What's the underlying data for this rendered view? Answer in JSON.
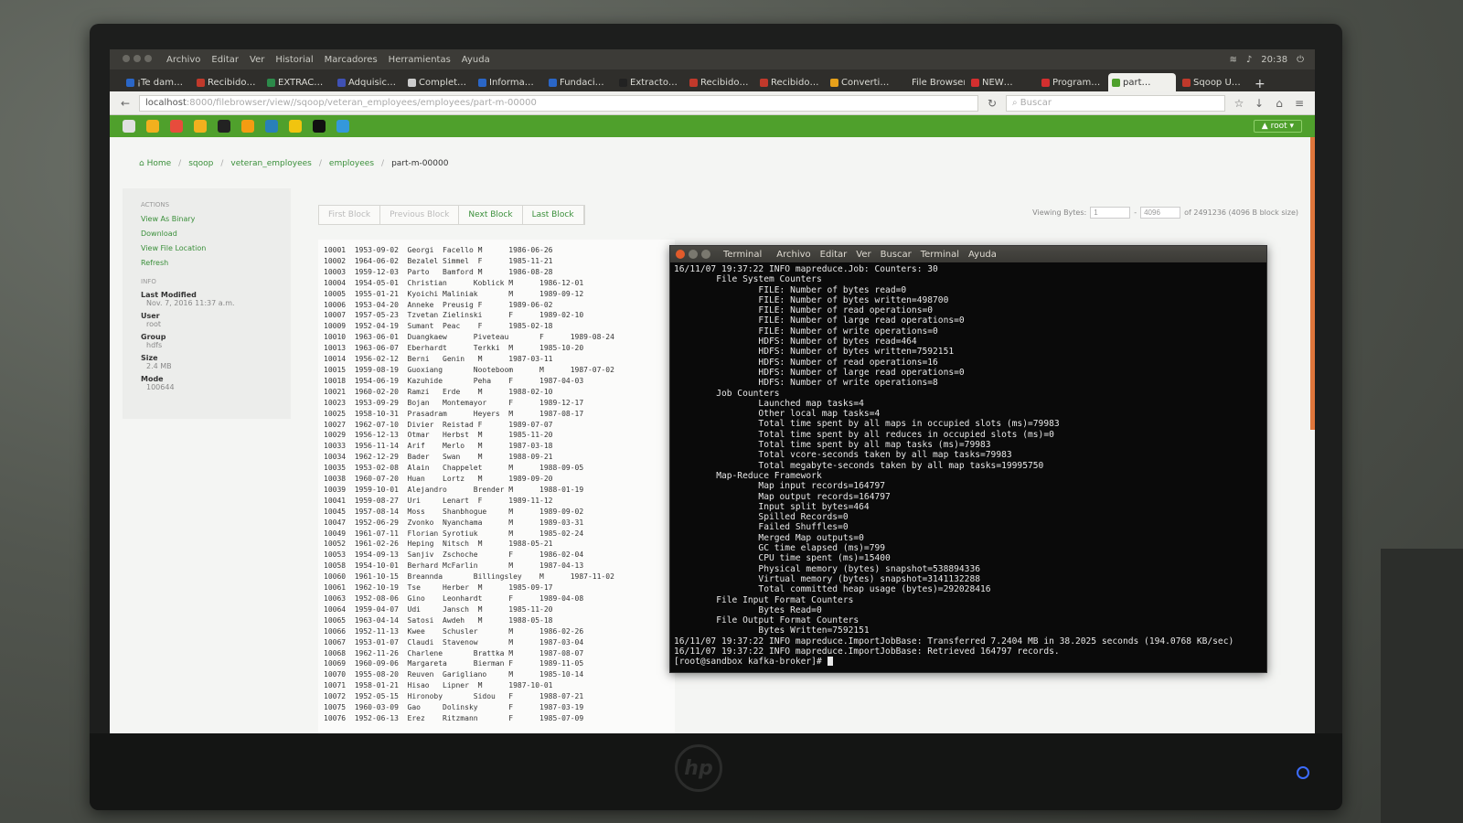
{
  "os_bar": {
    "menus": [
      "Archivo",
      "Editar",
      "Ver",
      "Historial",
      "Marcadores",
      "Herramientas",
      "Ayuda"
    ],
    "clock": "20:38"
  },
  "tabs": [
    {
      "label": "¡Te dam…",
      "color": "#2a66c7"
    },
    {
      "label": "Recibido…",
      "color": "#c0392b"
    },
    {
      "label": "EXTRAC…",
      "color": "#2c8a4a"
    },
    {
      "label": "Adquisic…",
      "color": "#3f51b5"
    },
    {
      "label": "Complet…",
      "color": "#cccccc"
    },
    {
      "label": "Informa…",
      "color": "#2a66c7"
    },
    {
      "label": "Fundaci…",
      "color": "#2a66c7"
    },
    {
      "label": "Extracto…",
      "color": "#222222"
    },
    {
      "label": "Recibido…",
      "color": "#c0392b"
    },
    {
      "label": "Recibido…",
      "color": "#c0392b"
    },
    {
      "label": "Converti…",
      "color": "#e6a01a"
    },
    {
      "label": "File Browser",
      "color": "#2f2e2b"
    },
    {
      "label": "NEW…",
      "color": "#d32f2f"
    },
    {
      "label": "Program…",
      "color": "#d32f2f"
    },
    {
      "label": "part…",
      "color": "#4fa02c",
      "active": true
    },
    {
      "label": "Sqoop U…",
      "color": "#c0392b"
    }
  ],
  "url": {
    "host": "localhost",
    "path": ":8000/filebrowser/view//sqoop/veteran_employees/employees/part-m-00000"
  },
  "search": {
    "placeholder": "Buscar"
  },
  "hue": {
    "user": "root"
  },
  "breadcrumb": {
    "home": "Home",
    "parts": [
      "sqoop",
      "veteran_employees",
      "employees"
    ],
    "current": "part-m-00000"
  },
  "sidebar": {
    "actions_header": "ACTIONS",
    "actions": [
      "View As Binary",
      "Download",
      "View File Location",
      "Refresh"
    ],
    "info_header": "INFO",
    "last_modified_label": "Last Modified",
    "last_modified": "Nov. 7, 2016 11:37 a.m.",
    "user_label": "User",
    "user": "root",
    "group_label": "Group",
    "group": "hdfs",
    "size_label": "Size",
    "size": "2.4 MB",
    "mode_label": "Mode",
    "mode": "100644"
  },
  "block_nav": {
    "first": "First Block",
    "previous": "Previous Block",
    "next": "Next Block",
    "last": "Last Block"
  },
  "viewing": {
    "label": "Viewing Bytes:",
    "from": "1",
    "to": "4096",
    "suffix": "of 2491236 (4096 B block size)"
  },
  "file_lines": [
    "10001  1953-09-02  Georgi  Facello M      1986-06-26",
    "10002  1964-06-02  Bezalel Simmel  F      1985-11-21",
    "10003  1959-12-03  Parto   Bamford M      1986-08-28",
    "10004  1954-05-01  Christian      Koblick M      1986-12-01",
    "10005  1955-01-21  Kyoichi Maliniak       M      1989-09-12",
    "10006  1953-04-20  Anneke  Preusig F      1989-06-02",
    "10007  1957-05-23  Tzvetan Zielinski      F      1989-02-10",
    "10009  1952-04-19  Sumant  Peac    F      1985-02-18",
    "10010  1963-06-01  Duangkaew      Piveteau       F      1989-08-24",
    "10013  1963-06-07  Eberhardt      Terkki  M      1985-10-20",
    "10014  1956-02-12  Berni   Genin   M      1987-03-11",
    "10015  1959-08-19  Guoxiang       Nooteboom      M      1987-07-02",
    "10018  1954-06-19  Kazuhide       Peha    F      1987-04-03",
    "10021  1960-02-20  Ramzi   Erde    M      1988-02-10",
    "10023  1953-09-29  Bojan   Montemayor     F      1989-12-17",
    "10025  1958-10-31  Prasadram      Heyers  M      1987-08-17",
    "10027  1962-07-10  Divier  Reistad F      1989-07-07",
    "10029  1956-12-13  Otmar   Herbst  M      1985-11-20",
    "10033  1956-11-14  Arif    Merlo   M      1987-03-18",
    "10034  1962-12-29  Bader   Swan    M      1988-09-21",
    "10035  1953-02-08  Alain   Chappelet      M      1988-09-05",
    "10038  1960-07-20  Huan    Lortz   M      1989-09-20",
    "10039  1959-10-01  Alejandro      Brender M      1988-01-19",
    "10041  1959-08-27  Uri     Lenart  F      1989-11-12",
    "10045  1957-08-14  Moss    Shanbhogue     M      1989-09-02",
    "10047  1952-06-29  Zvonko  Nyanchama      M      1989-03-31",
    "10049  1961-07-11  Florian Syrotiuk       M      1985-02-24",
    "10052  1961-02-26  Heping  Nitsch  M      1988-05-21",
    "10053  1954-09-13  Sanjiv  Zschoche       F      1986-02-04",
    "10058  1954-10-01  Berhard McFarlin       M      1987-04-13",
    "10060  1961-10-15  Breannda       Billingsley    M      1987-11-02",
    "10061  1962-10-19  Tse     Herber  M      1985-09-17",
    "10063  1952-08-06  Gino    Leonhardt      F      1989-04-08",
    "10064  1959-04-07  Udi     Jansch  M      1985-11-20",
    "10065  1963-04-14  Satosi  Awdeh   M      1988-05-18",
    "10066  1952-11-13  Kwee    Schusler       M      1986-02-26",
    "10067  1953-01-07  Claudi  Stavenow       M      1987-03-04",
    "10068  1962-11-26  Charlene       Brattka M      1987-08-07",
    "10069  1960-09-06  Margareta      Bierman F      1989-11-05",
    "10070  1955-08-20  Reuven  Garigliano     M      1985-10-14",
    "10071  1958-01-21  Hisao   Lipner  M      1987-10-01",
    "10072  1952-05-15  Hironoby       Sidou   F      1988-07-21",
    "10075  1960-03-09  Gao     Dolinsky       F      1987-03-19",
    "10076  1952-06-13  Erez    Ritzmann       F      1985-07-09"
  ],
  "terminal": {
    "title": "Terminal",
    "menus": [
      "Archivo",
      "Editar",
      "Ver",
      "Buscar",
      "Terminal",
      "Ayuda"
    ],
    "lines": [
      "16/11/07 19:37:22 INFO mapreduce.Job: Counters: 30",
      "        File System Counters",
      "                FILE: Number of bytes read=0",
      "                FILE: Number of bytes written=498700",
      "                FILE: Number of read operations=0",
      "                FILE: Number of large read operations=0",
      "                FILE: Number of write operations=0",
      "                HDFS: Number of bytes read=464",
      "                HDFS: Number of bytes written=7592151",
      "                HDFS: Number of read operations=16",
      "                HDFS: Number of large read operations=0",
      "                HDFS: Number of write operations=8",
      "        Job Counters",
      "                Launched map tasks=4",
      "                Other local map tasks=4",
      "                Total time spent by all maps in occupied slots (ms)=79983",
      "                Total time spent by all reduces in occupied slots (ms)=0",
      "                Total time spent by all map tasks (ms)=79983",
      "                Total vcore-seconds taken by all map tasks=79983",
      "                Total megabyte-seconds taken by all map tasks=19995750",
      "        Map-Reduce Framework",
      "                Map input records=164797",
      "                Map output records=164797",
      "                Input split bytes=464",
      "                Spilled Records=0",
      "                Failed Shuffles=0",
      "                Merged Map outputs=0",
      "                GC time elapsed (ms)=799",
      "                CPU time spent (ms)=15400",
      "                Physical memory (bytes) snapshot=538894336",
      "                Virtual memory (bytes) snapshot=3141132288",
      "                Total committed heap usage (bytes)=292028416",
      "        File Input Format Counters",
      "                Bytes Read=0",
      "        File Output Format Counters",
      "                Bytes Written=7592151",
      "16/11/07 19:37:22 INFO mapreduce.ImportJobBase: Transferred 7.2404 MB in 38.2025 seconds (194.0768 KB/sec)",
      "16/11/07 19:37:22 INFO mapreduce.ImportJobBase: Retrieved 164797 records."
    ],
    "prompt": "[root@sandbox kafka-broker]# "
  },
  "hue_app_colors": [
    "#e0e0e0",
    "#f2b01e",
    "#e74c3c",
    "#f2b01e",
    "#222222",
    "#f39c12",
    "#2980b9",
    "#f1c40f",
    "#111111",
    "#3498db"
  ],
  "bezel": {
    "brand": "hp"
  }
}
